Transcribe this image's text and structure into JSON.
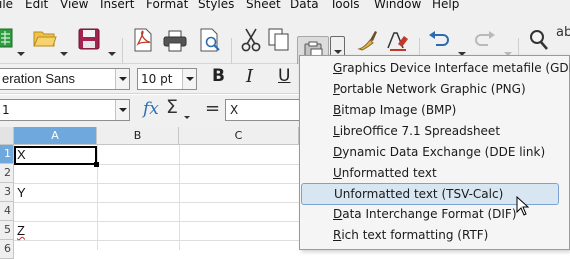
{
  "menubar": {
    "items": [
      {
        "name": "file",
        "label": "ile"
      },
      {
        "name": "edit",
        "label": "Edit"
      },
      {
        "name": "view",
        "label": "View"
      },
      {
        "name": "insert",
        "label": "Insert"
      },
      {
        "name": "format",
        "label": "Format"
      },
      {
        "name": "styles",
        "label": "Styles"
      },
      {
        "name": "sheet",
        "label": "Sheet"
      },
      {
        "name": "data",
        "label": "Data"
      },
      {
        "name": "tools",
        "label": "Tools"
      },
      {
        "name": "window",
        "label": "Window"
      },
      {
        "name": "help",
        "label": "Help"
      }
    ]
  },
  "toolbar": {
    "icons": [
      "new-spreadsheet-icon",
      "open-folder-icon",
      "save-icon",
      "export-pdf-icon",
      "print-icon",
      "print-preview-icon",
      "cut-icon",
      "copy-icon",
      "paste-icon",
      "clone-formatting-icon",
      "clear-formatting-icon",
      "undo-icon",
      "redo-icon",
      "find-replace-icon",
      "spelling-icon"
    ],
    "spelling_glyph": "ab"
  },
  "formatting": {
    "font_name": "Liberation Sans",
    "font_name_visible": "eration Sans",
    "font_size": "10 pt",
    "bold": "B",
    "italic": "I",
    "underline": "U"
  },
  "formula": {
    "name_box": "1",
    "fx": "fx",
    "sigma": "Σ",
    "equals": "=",
    "content": "X"
  },
  "grid": {
    "columns": [
      {
        "label": "A",
        "active": true
      },
      {
        "label": "B",
        "active": false
      },
      {
        "label": "C",
        "active": false
      }
    ],
    "rows": [
      {
        "label": "1",
        "active": true,
        "a": "X"
      },
      {
        "label": "2",
        "active": false,
        "a": ""
      },
      {
        "label": "3",
        "active": false,
        "a": "Y"
      },
      {
        "label": "4",
        "active": false,
        "a": ""
      },
      {
        "label": "5",
        "active": false,
        "a": "Z"
      },
      {
        "label": "6",
        "active": false,
        "a": ""
      }
    ]
  },
  "paste_special_menu": {
    "items": [
      {
        "label": "Graphics Device Interface metafile (GDI)",
        "mnemonic": "G"
      },
      {
        "label": "Portable Network Graphic (PNG)",
        "mnemonic": "P"
      },
      {
        "label": "Bitmap Image (BMP)",
        "mnemonic": "B"
      },
      {
        "label": "LibreOffice 7.1 Spreadsheet",
        "mnemonic": "L"
      },
      {
        "label": "Dynamic Data Exchange (DDE link)",
        "mnemonic": "D"
      },
      {
        "label": "Unformatted text",
        "mnemonic": "U"
      },
      {
        "label": "Unformatted text (TSV-Calc)",
        "mnemonic": "",
        "hover": true
      },
      {
        "label": "Data Interchange Format (DIF)",
        "mnemonic": "D"
      },
      {
        "label": "Rich text formatting (RTF)",
        "mnemonic": "R"
      }
    ]
  },
  "colors": {
    "accent": "#6fa8dc",
    "hover_bg": "#d8e6f2",
    "hover_border": "#7da2ce",
    "spell_error": "#d0261c"
  }
}
